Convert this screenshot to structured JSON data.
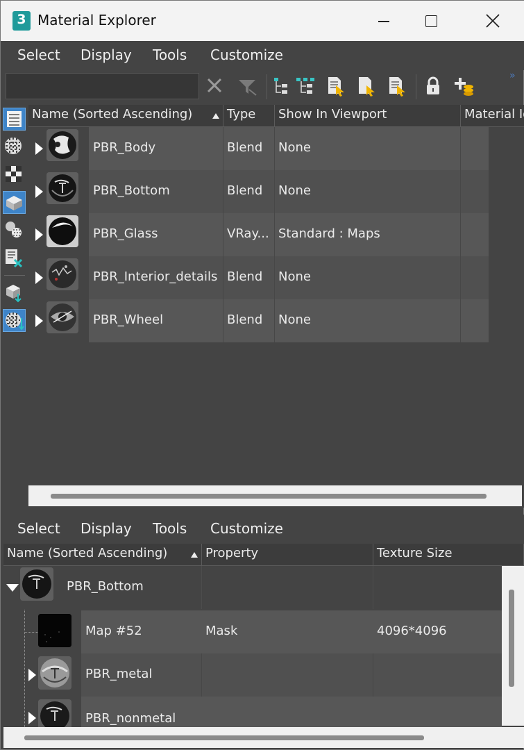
{
  "window": {
    "title": "Material Explorer",
    "app_icon_glyph": "3"
  },
  "top_menu": [
    "Select",
    "Display",
    "Tools",
    "Customize"
  ],
  "toolbar": {
    "search_value": "",
    "search_placeholder": "",
    "more_glyph": "»",
    "icons": [
      "clear-search-icon",
      "filter-icon",
      "expand-all-icon",
      "collapse-all-icon",
      "select-objects-icon",
      "select-all-icon",
      "sync-icon",
      "lock-icon",
      "add-material-icon"
    ]
  },
  "left_toolbar_icons": [
    {
      "name": "display-materials-icon",
      "active": true
    },
    {
      "name": "display-maps-icon",
      "active": false
    },
    {
      "name": "checker-maps-icon",
      "active": false
    },
    {
      "name": "display-objects-icon",
      "active": true
    },
    {
      "name": "sub-materials-icon",
      "active": false
    },
    {
      "name": "unused-maps-icon",
      "active": false
    },
    {
      "name": "scene-materials-icon",
      "active": false
    },
    {
      "name": "material-override-icon",
      "active": true
    }
  ],
  "upper_table": {
    "columns": [
      "Name (Sorted Ascending)",
      "Type",
      "Show In Viewport",
      "Material Id"
    ],
    "rows": [
      {
        "name": "PBR_Body",
        "type": "Blend",
        "viewport": "None"
      },
      {
        "name": "PBR_Bottom",
        "type": "Blend",
        "viewport": "None"
      },
      {
        "name": "PBR_Glass",
        "type": "VRay...",
        "viewport": "Standard : Maps"
      },
      {
        "name": "PBR_Interior_details",
        "type": "Blend",
        "viewport": "None"
      },
      {
        "name": "PBR_Wheel",
        "type": "Blend",
        "viewport": "None"
      }
    ]
  },
  "bottom_menu": [
    "Select",
    "Display",
    "Tools",
    "Customize"
  ],
  "lower_table": {
    "columns": [
      "Name (Sorted Ascending)",
      "Property",
      "Texture Size"
    ],
    "rows": [
      {
        "name": "PBR_Bottom",
        "property": "",
        "texture_size": "",
        "level": 0,
        "expanded": true
      },
      {
        "name": "Map #52",
        "property": "Mask",
        "texture_size": "4096*4096",
        "level": 1,
        "expanded": null
      },
      {
        "name": "PBR_metal",
        "property": "",
        "texture_size": "",
        "level": 1,
        "expanded": false
      },
      {
        "name": "PBR_nonmetal",
        "property": "",
        "texture_size": "",
        "level": 1,
        "expanded": false
      }
    ]
  },
  "colors": {
    "panel": "#444444",
    "accent": "#3e84c8",
    "row_odd": "#575757",
    "row_even": "#505050"
  }
}
